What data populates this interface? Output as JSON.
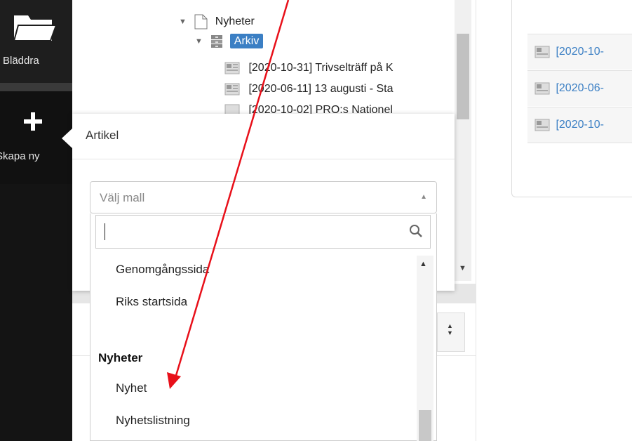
{
  "nav": {
    "browse_label": "Bläddra",
    "create_label": "Skapa ny"
  },
  "tree": {
    "root_label": "Nyheter",
    "archive_label": "Arkiv",
    "items": [
      "[2020-10-31] Trivselträff på K",
      "[2020-06-11] 13 augusti - Sta",
      "[2020-10-02] PRO:s Nationel"
    ]
  },
  "right_list": {
    "items": [
      "[2020-10-",
      "[2020-06-",
      "[2020-10-"
    ]
  },
  "popup": {
    "title": "Artikel",
    "select_placeholder": "Välj mall",
    "search_value": "",
    "options_top": [
      "Genomgångssida",
      "Riks startsida"
    ],
    "group_label": "Nyheter",
    "group_options": [
      "Nyhet",
      "Nyhetslistning"
    ]
  },
  "annotation": {
    "arrow_color": "#e8101a"
  },
  "colors": {
    "accent": "#3b7fc4",
    "nav_bg": "#141414"
  }
}
